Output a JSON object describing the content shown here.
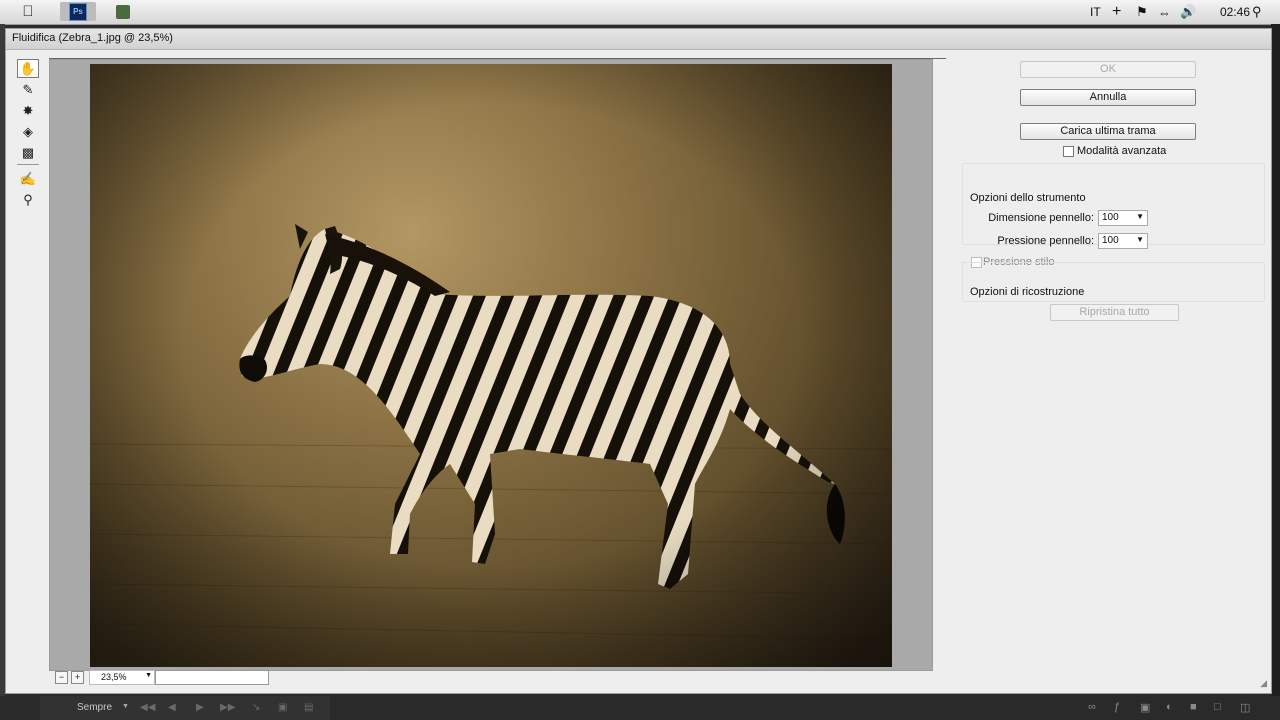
{
  "menubar": {
    "tray": {
      "lang": "IT",
      "clock": "02:46"
    },
    "ps_icon_text": "Ps"
  },
  "dialog": {
    "title": "Fluidifica (Zebra_1.jpg @ 23,5%)"
  },
  "toolbar": {
    "tools": [
      "warp-tool-icon",
      "reconstruct-tool-icon",
      "pucker-tool-icon",
      "bloat-tool-icon",
      "freeze-mask-icon",
      "hand-tool-icon",
      "zoom-tool-icon"
    ]
  },
  "zoom": {
    "minus": "−",
    "plus": "+",
    "value": "23,5%"
  },
  "panel": {
    "ok": "OK",
    "cancel": "Annulla",
    "load_last_mesh": "Carica ultima trama",
    "advanced_mode": "Modalità avanzata",
    "tool_options_title": "Opzioni dello strumento",
    "brush_size_label": "Dimensione pennello:",
    "brush_size_value": "100",
    "brush_pressure_label": "Pressione pennello:",
    "brush_pressure_value": "100",
    "stylus_pressure": "Pressione stilo",
    "reconstruct_options_title": "Opzioni di ricostruzione",
    "restore_all": "Ripristina tutto"
  },
  "psbar": {
    "sempre": "Sempre"
  },
  "colors": {
    "ps_blue": "#0b2a55",
    "dialog_bg": "#eeeeee",
    "preview_bg": "#a9a9a9"
  }
}
